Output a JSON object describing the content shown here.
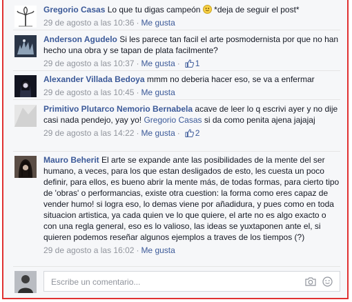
{
  "comments": [
    {
      "author": "Gregorio Casas",
      "text": "Lo que tu digas campeón",
      "text_after": "*deja de seguir el post*",
      "timestamp": "29 de agosto a las 10:36",
      "like_label": "Me gusta"
    },
    {
      "author": "Anderson Agudelo",
      "text": "Si les parece tan facil el arte posmodernista por que no han hecho una obra y se tapan de plata facilmente?",
      "timestamp": "29 de agosto a las 10:37",
      "like_label": "Me gusta",
      "likes": "1"
    },
    {
      "author": "Alexander Villada Bedoya",
      "text": "mmm no deberia hacer eso, se va a enfermar",
      "timestamp": "29 de agosto a las 10:45",
      "like_label": "Me gusta"
    },
    {
      "author": "Primitivo Plutarco Nemorio Bernabela",
      "text": "acave de leer lo q escrivi ayer y no dije casi nada pendejo, yay yo!",
      "mention": "Gregorio Casas",
      "text_after": "si da como penita ajena jajajaj",
      "timestamp": "29 de agosto a las 14:22",
      "like_label": "Me gusta",
      "likes": "2"
    },
    {
      "author": "Mauro Beherit",
      "text": "El arte se expande ante las posibilidades de la mente del ser humano, a veces, para los que estan desligados de esto, les cuesta un poco definir, para ellos, es bueno abrir la mente más, de todas formas, para cierto tipo de 'obras' o performancias, existe otra cuestion: la forma como eres capaz de vender humo! si logra eso, lo demas viene por añadidura, y pues como en toda situacion artistica, ya cada quien ve lo que quiere, el arte no es algo exacto o con una regla general, eso es lo valioso, las ideas se yuxtaponen ante el, si quieren podemos reseñar algunos ejemplos a traves de los tiempos (?)",
      "timestamp": "29 de agosto a las 16:02",
      "like_label": "Me gusta"
    }
  ],
  "composer": {
    "placeholder": "Escribe un comentario..."
  },
  "icons": {
    "like": "thumbs-up-icon",
    "camera": "camera-icon",
    "emoji": "smile-icon"
  },
  "colors": {
    "link": "#3b5998",
    "meta": "#90949c",
    "border_highlight": "#e03030"
  }
}
